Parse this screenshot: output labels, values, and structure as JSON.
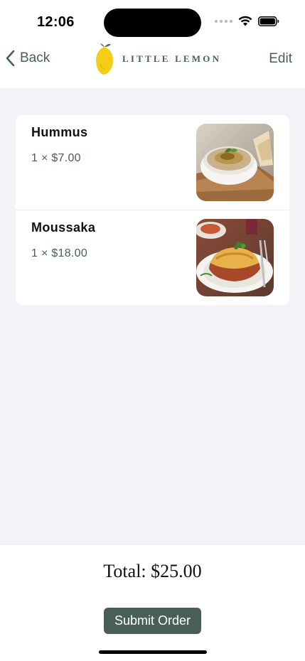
{
  "status": {
    "time": "12:06"
  },
  "nav": {
    "back_label": "Back",
    "logo_text": "LITTLE LEMON",
    "edit_label": "Edit"
  },
  "order": {
    "items": [
      {
        "name": "Hummus",
        "qty_price": "1 × $7.00",
        "image": "hummus-photo"
      },
      {
        "name": "Moussaka",
        "qty_price": "1 × $18.00",
        "image": "moussaka-photo"
      }
    ]
  },
  "footer": {
    "total": "Total: $25.00",
    "submit_label": "Submit Order"
  },
  "colors": {
    "brand_green": "#495e57",
    "brand_yellow": "#f4ce14",
    "background": "#f2f2f7"
  }
}
